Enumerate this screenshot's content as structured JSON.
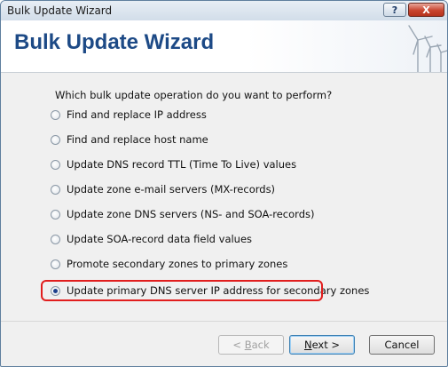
{
  "window": {
    "title": "Bulk Update Wizard",
    "help_label": "?",
    "close_label": "X"
  },
  "header": {
    "title": "Bulk Update Wizard"
  },
  "main": {
    "prompt": "Which bulk update operation do you want to perform?",
    "options": [
      {
        "label": "Find and replace IP address",
        "checked": false
      },
      {
        "label": "Find and replace host name",
        "checked": false
      },
      {
        "label": "Update DNS record TTL (Time To Live) values",
        "checked": false
      },
      {
        "label": "Update zone e-mail servers (MX-records)",
        "checked": false
      },
      {
        "label": "Update zone DNS servers (NS- and SOA-records)",
        "checked": false
      },
      {
        "label": "Update SOA-record data field values",
        "checked": false
      },
      {
        "label": "Promote secondary zones to primary zones",
        "checked": false
      },
      {
        "label": "Update primary DNS server IP address for secondary zones",
        "checked": true
      }
    ],
    "highlight_color": "#e11e1e"
  },
  "footer": {
    "back": {
      "prefix": "< ",
      "mnemonic": "B",
      "rest": "ack"
    },
    "next": {
      "mnemonic": "N",
      "rest": "ext >"
    },
    "cancel": "Cancel"
  }
}
